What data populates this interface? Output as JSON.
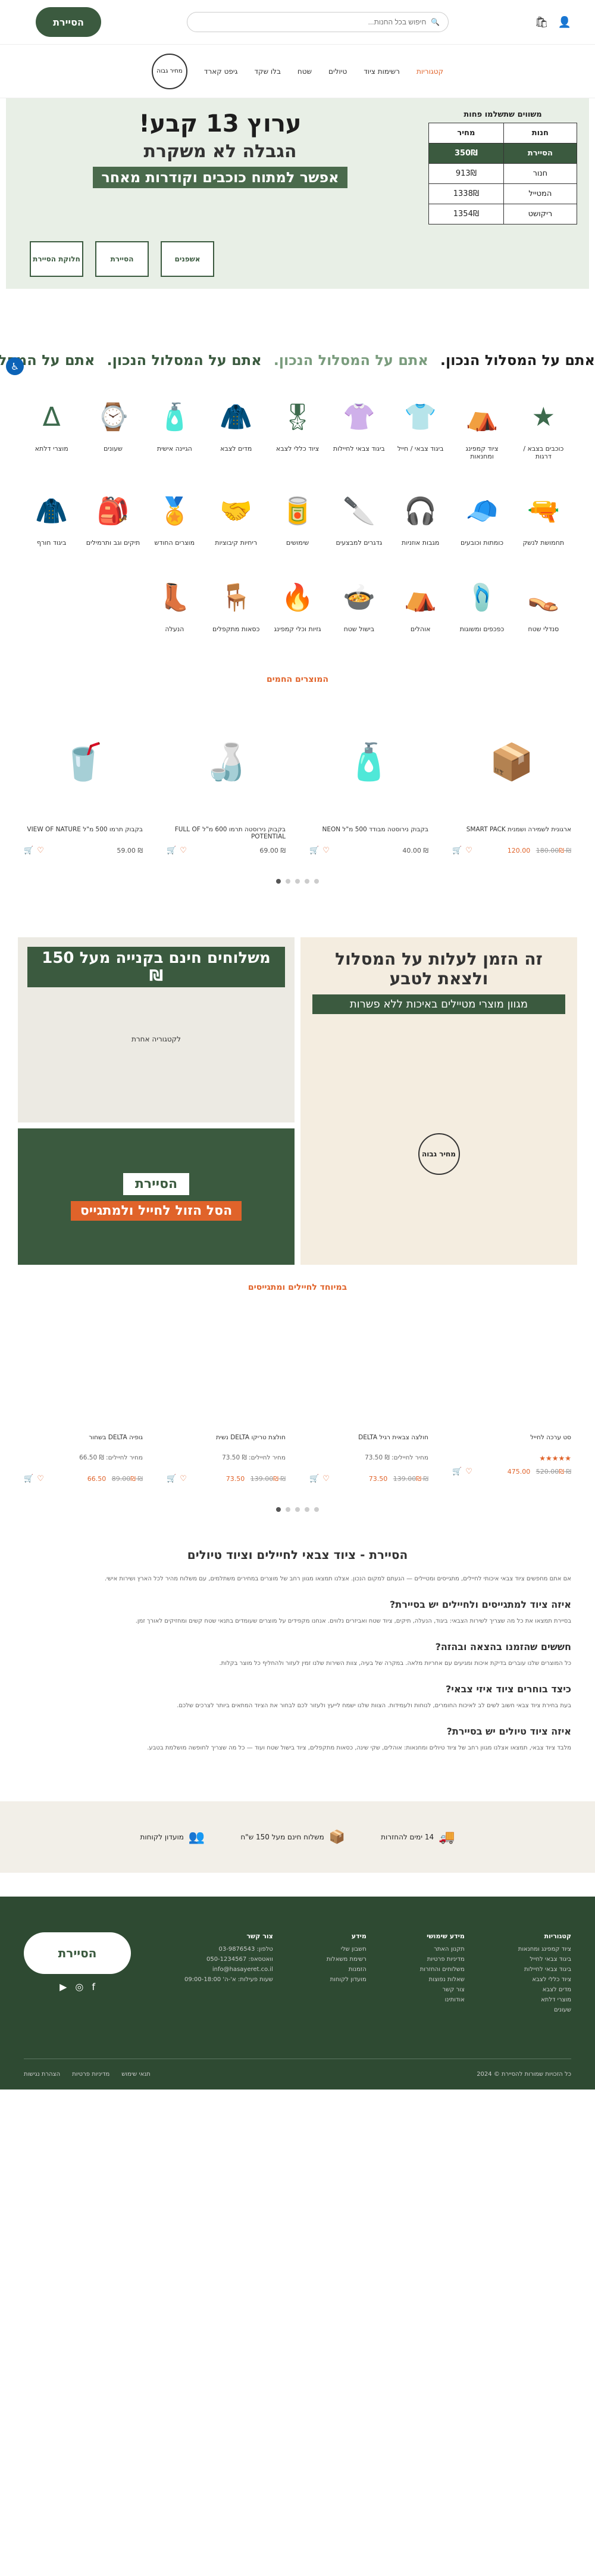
{
  "header": {
    "logo_text": "הסיירת",
    "search_placeholder": "חיפוש בכל החנות...",
    "cart_icon": "bag-icon",
    "user_icon": "user-icon"
  },
  "nav": {
    "categories_label": "קטגוריות",
    "items": [
      "רשימות ציוד",
      "טיולים",
      "שטח",
      "בלו שקד",
      "גיפט קארד"
    ],
    "stamp_label": "מחיר גבוה"
  },
  "hero": {
    "title": "ערוץ 13 קבע!",
    "subtitle": "הגבלה לא משקרת",
    "line": "אפשר למתוח כוכבים וקודרות מאחר",
    "table_title": "משווים שתשלמו פחות",
    "table": {
      "headers": [
        "חנות",
        "מחיר"
      ],
      "rows": [
        [
          "הסיירת",
          "350₪",
          true
        ],
        [
          "חנור",
          "913₪",
          false
        ],
        [
          "המטייל",
          "1338₪",
          false
        ],
        [
          "ריקושט",
          "1354₪",
          false
        ]
      ]
    },
    "badge_left": "חלוקת הסיירת",
    "badge_mid": "הסיירת",
    "badge_card": "אשפנים"
  },
  "marquee": {
    "text_a": "אתם על המסלול הנכון.",
    "text_b": "אתם על המסלול הנכון.",
    "text_c": "אתם על המסלול הנכון.",
    "text_d": "אתם על המסלול הנכו"
  },
  "categories": [
    {
      "label": "כוכבים בצבא / דרגות",
      "icon": "★"
    },
    {
      "label": "ציוד קמפינג ומחנאות",
      "icon": "⛺"
    },
    {
      "label": "ביגוד צבאי / חייל",
      "icon": "👕"
    },
    {
      "label": "ביגוד צבאי לחיילות",
      "icon": "👚"
    },
    {
      "label": "ציוד כללי לצבא",
      "icon": "🎖"
    },
    {
      "label": "מדים לצבא",
      "icon": "🧥"
    },
    {
      "label": "הגיינה אישית",
      "icon": "🧴"
    },
    {
      "label": "שעונים",
      "icon": "⌚"
    },
    {
      "label": "מוצרי דלתא",
      "icon": "Δ"
    },
    {
      "label": "תחמושת לנשק",
      "icon": "🔫"
    },
    {
      "label": "כומתות וכובעים",
      "icon": "🧢"
    },
    {
      "label": "מגבות אוזניות",
      "icon": "🎧"
    },
    {
      "label": "גדגרים למבצעים",
      "icon": "🔪"
    },
    {
      "label": "שימושים",
      "icon": "🥫"
    },
    {
      "label": "ריחיות קיבוציות",
      "icon": "🤝"
    },
    {
      "label": "מוצרים החודש",
      "icon": "🏅"
    },
    {
      "label": "תיקים וגב ותרמילים",
      "icon": "🎒"
    },
    {
      "label": "ביגוד חורף",
      "icon": "🧥"
    },
    {
      "label": "סנדלי שטח",
      "icon": "👡"
    },
    {
      "label": "כפכפים ומשוגות",
      "icon": "🩴"
    },
    {
      "label": "אוהלים",
      "icon": "⛺"
    },
    {
      "label": "בישול שטח",
      "icon": "🍲"
    },
    {
      "label": "גזיות וכלי קמפינג",
      "icon": "🔥"
    },
    {
      "label": "כסאות מתקפלים",
      "icon": "🪑"
    },
    {
      "label": "הנעלה",
      "icon": "👢"
    }
  ],
  "hot_products": {
    "title": "המוצרים החמים",
    "items": [
      {
        "name": "ארגונית לשמירה ושמנית SMART PACK",
        "old": "₪ 180.00",
        "price": "₪ 120.00",
        "emoji": "📦"
      },
      {
        "name": "בקבוק נירוסטה מבודד 500 מ\"ל NEON",
        "old": "",
        "price": "₪ 40.00",
        "emoji": "🧴"
      },
      {
        "name": "בקבוק נירוסטה תרמו 600 מ\"ל FULL OF POTENTIAL",
        "old": "",
        "price": "₪ 69.00",
        "emoji": "🍶"
      },
      {
        "name": "בקבוק תרמו 500 מ\"ל VIEW OF NATURE",
        "old": "",
        "price": "₪ 59.00",
        "emoji": "🥤"
      }
    ]
  },
  "banners": {
    "right_title": "זה הזמן לעלות על המסלול ולצאת לטבע",
    "right_sub": "מגוון מוצרי מטיילים באיכות ללא פשרות",
    "right_stamp": "מחיר גבוה",
    "top_title": "משלוחים חינם בקנייה מעל 150 ₪",
    "top_cta": "לקטגוריה אחרת",
    "bottom_logo": "הסיירת",
    "bottom_line": "הסל הזול לחייל ולמתגייס"
  },
  "soldiers": {
    "title": "במיוחד לחיילים ומתגייסים",
    "items": [
      {
        "name": "סט ערכה לחייל",
        "old": "₪ 520.00",
        "price": "₪ 475.00",
        "rating": "★★★★★",
        "extra": ""
      },
      {
        "name": "חולצה צבאית רגיל DELTA",
        "old": "₪ 139.00",
        "price": "₪ 73.50",
        "rating": "",
        "extra": "מחיר לחיילים: ₪ 73.50"
      },
      {
        "name": "חולצת טריקו DELTA נשית",
        "old": "₪ 139.00",
        "price": "₪ 73.50",
        "rating": "",
        "extra": "מחיר לחיילים: ₪ 73.50"
      },
      {
        "name": "גופיה DELTA בשחור",
        "old": "₪ 89.00",
        "price": "₪ 66.50",
        "rating": "",
        "extra": "מחיר לחיילים: ₪ 66.50"
      }
    ]
  },
  "seo": {
    "title": "הסיירת - ציוד צבאי לחיילים וציוד טיולים",
    "intro": "אם אתם מחפשים ציוד צבאי איכותי לחיילים, מתגייסים ומטיילים — הגעתם למקום הנכון. אצלנו תמצאו מגוון רחב של מוצרים במחירים משתלמים, עם משלוח מהיר לכל הארץ ושירות אישי.",
    "h1": "איזה ציוד למתגייסים ולחיילים יש בסיירת?",
    "p1": "בסיירת תמצאו את כל מה שצריך לשירות הצבאי: ביגוד, הנעלה, תיקים, ציוד שטח ואביזרים נלווים. אנחנו מקפידים על מוצרים שעומדים בתנאי שטח קשים ומחזיקים לאורך זמן.",
    "h2": "חששים שהזמנו בהצאה ובהזה?",
    "p2": "כל המוצרים שלנו עוברים בדיקת איכות ומגיעים עם אחריות מלאה. במקרה של בעיה, צוות השירות שלנו זמין לעזור ולהחליף כל מוצר בקלות.",
    "h3": "כיצד בוחרים ציוד איזי צבאי?",
    "p3": "בעת בחירת ציוד צבאי חשוב לשים לב לאיכות החומרים, לנוחות ולעמידות. הצוות שלנו ישמח לייעץ ולעזור לכם לבחור את הציוד המתאים ביותר לצרכים שלכם.",
    "h4": "איזה ציוד טיולים יש בסיירת?",
    "p4": "מלבד ציוד צבאי, תמצאו אצלנו מגוון רחב של ציוד טיולים ומחנאות: אוהלים, שקי שינה, כסאות מתקפלים, ציוד בישול שטח ועוד — כל מה שצריך לחופשה מושלמת בטבע."
  },
  "features": [
    {
      "icon": "🚚",
      "label": "14 ימים להחזרות"
    },
    {
      "icon": "📦",
      "label": "משלוח חינם מעל 150 ש\"ח"
    },
    {
      "icon": "👥",
      "label": "מועדון לקוחות"
    }
  ],
  "footer": {
    "logo": "הסיירת",
    "cols": [
      {
        "title": "קטגוריות",
        "links": [
          "ציוד קמפינג ומחנאות",
          "ביגוד צבאי לחייל",
          "ביגוד צבאי לחיילות",
          "ציוד כללי לצבא",
          "מדים לצבא",
          "מוצרי דלתא",
          "שעונים"
        ]
      },
      {
        "title": "מידע שימושי",
        "links": [
          "תקנון האתר",
          "מדיניות פרטיות",
          "משלוחים והחזרות",
          "שאלות נפוצות",
          "צור קשר",
          "אודותינו"
        ]
      },
      {
        "title": "מידע",
        "links": [
          "חשבון שלי",
          "רשימת משאלות",
          "הזמנות",
          "מועדון לקוחות"
        ]
      },
      {
        "title": "צור קשר",
        "links": [
          "טלפון: 03-9876543",
          "וואטסאפ: 050-1234567",
          "info@hasayeret.co.il",
          "שעות פעילות: א'-ה' 09:00-18:00"
        ]
      }
    ],
    "copyright": "כל הזכויות שמורות להסיירת © 2024",
    "policy": [
      "תנאי שימוש",
      "מדיניות פרטיות",
      "הצהרת נגישות"
    ]
  }
}
